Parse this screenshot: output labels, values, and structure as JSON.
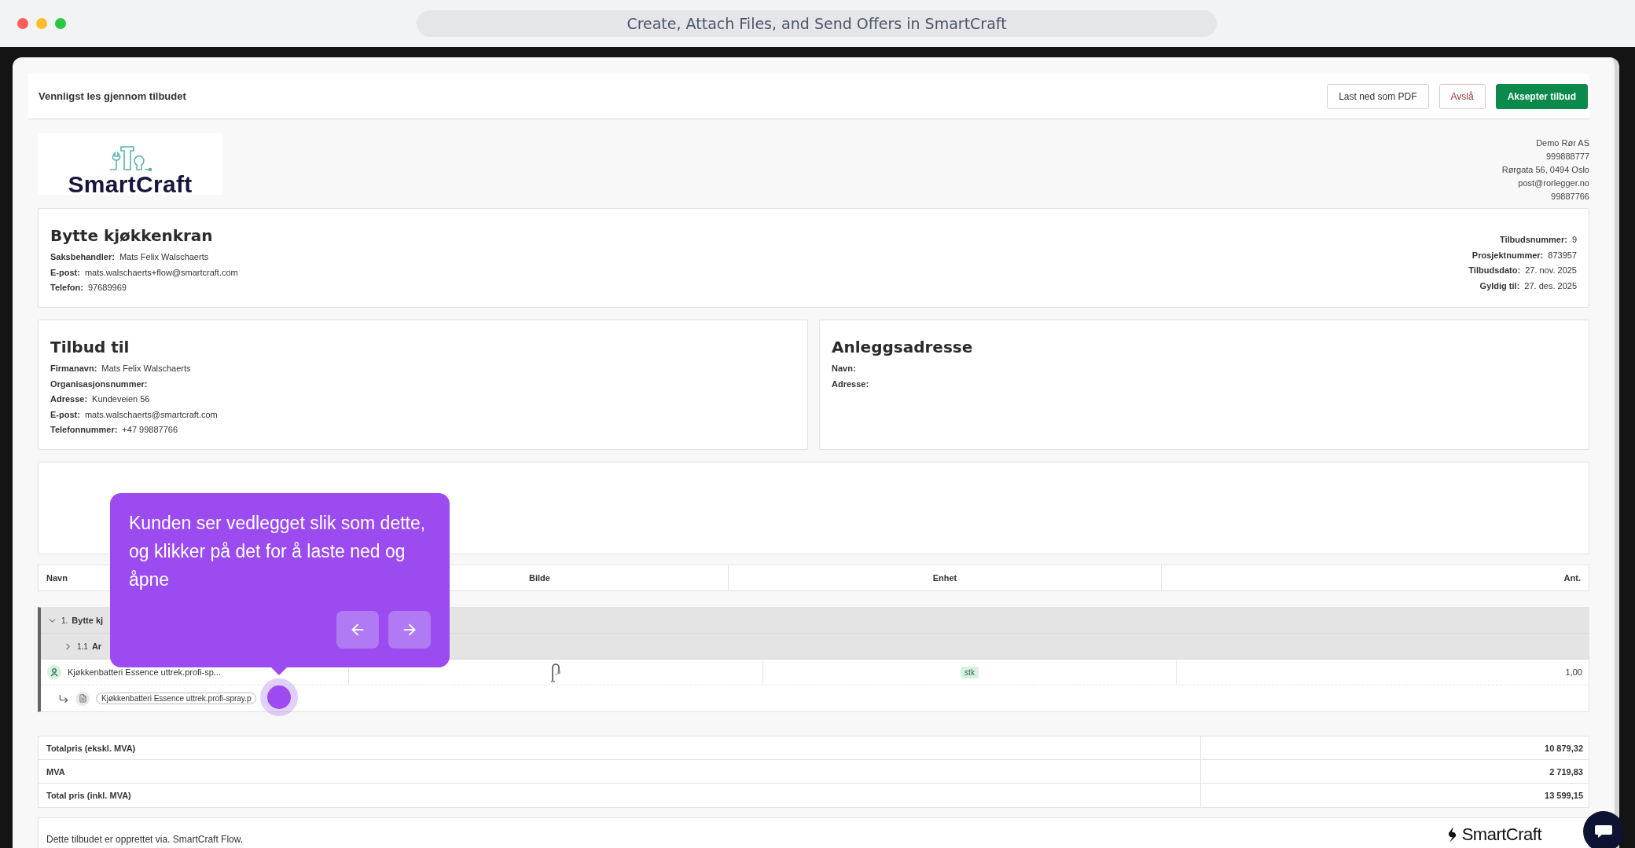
{
  "browser": {
    "title": "Create, Attach Files, and Send Offers in SmartCraft"
  },
  "header": {
    "title": "Vennligst les gjennom tilbudet",
    "buttons": [
      {
        "label": "Last ned som PDF",
        "kind": "outline"
      },
      {
        "label": "Avslå",
        "kind": "danger"
      },
      {
        "label": "Aksepter tilbud",
        "kind": "primary"
      }
    ]
  },
  "logo": {
    "text": "SmartCraft"
  },
  "company": [
    "Demo Rør AS",
    "999888777",
    "Rørgata 56, 0494 Oslo",
    "post@rorlegger.no",
    "99887766"
  ],
  "offer": {
    "title": "Bytte kjøkkenkran",
    "fields": [
      {
        "label": "Saksbehandler:",
        "value": "Mats Felix Walschaerts"
      },
      {
        "label": "E-post:",
        "value": "mats.walschaerts+flow@smartcraft.com"
      },
      {
        "label": "Telefon:",
        "value": "97689969"
      }
    ],
    "meta": [
      {
        "label": "Tilbudsnummer:",
        "value": "9"
      },
      {
        "label": "Prosjektnummer:",
        "value": "873957"
      },
      {
        "label": "Tilbudsdato:",
        "value": "27. nov. 2025"
      },
      {
        "label": "Gyldig til:",
        "value": "27. des. 2025"
      }
    ]
  },
  "recipient": {
    "title": "Tilbud til",
    "fields": [
      {
        "label": "Firmanavn:",
        "value": "Mats Felix Walschaerts"
      },
      {
        "label": "Organisasjonsnummer:"
      },
      {
        "label": "Adresse:",
        "value": "Kundeveien 56"
      },
      {
        "label": "E-post:",
        "value": "mats.walschaerts@smartcraft.com"
      },
      {
        "label": "Telefonnummer:",
        "value": "+47 99887766"
      }
    ]
  },
  "site": {
    "title": "Anleggsadresse",
    "fields": [
      {
        "label": "Navn:"
      },
      {
        "label": "Adresse:"
      }
    ]
  },
  "table": {
    "columns": [
      "Navn",
      "Bilde",
      "Enhet",
      "Ant."
    ],
    "rows": [
      {
        "kind": "group",
        "number": "1.",
        "name": "Bytte kj",
        "expanded": true
      },
      {
        "kind": "subgroup",
        "number": "1.1",
        "name": "Ar",
        "expanded": false
      },
      {
        "kind": "item",
        "name": "Kjøkkenbatteri Essence uttrek.profi-sp...",
        "unit": "stk",
        "quantity": "1,00"
      },
      {
        "kind": "attachment",
        "file": "Kjøkkenbatteri Essence uttrek.profi-spray.p"
      }
    ]
  },
  "totals": [
    {
      "label": "Totalpris (ekskl. MVA)",
      "value": "10 879,32"
    },
    {
      "label": "MVA",
      "value": "2 719,83"
    },
    {
      "label": "Total pris (inkl. MVA)",
      "value": "13 599,15"
    }
  ],
  "footer": {
    "text": "Dette tilbudet er opprettet via. SmartCraft Flow.",
    "brand": "SmartCraft"
  },
  "tour": {
    "text": "Kunden ser vedlegget slik som dette, og klikker på det for å laste ned og åpne"
  }
}
